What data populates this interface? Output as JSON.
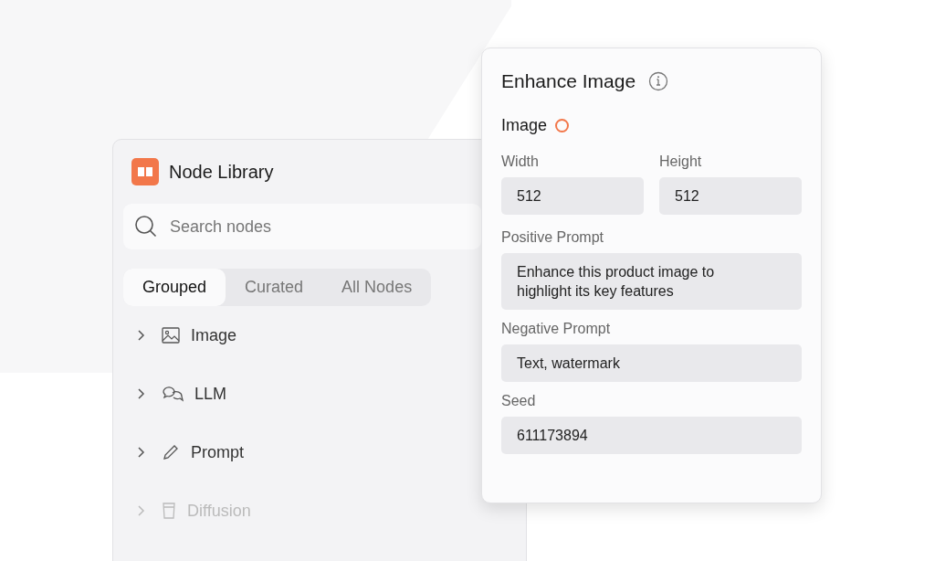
{
  "library": {
    "title": "Node Library",
    "search": {
      "placeholder": "Search nodes"
    },
    "tabs": [
      {
        "label": "Grouped",
        "selected": true
      },
      {
        "label": "Curated",
        "selected": false
      },
      {
        "label": "All Nodes",
        "selected": false
      }
    ],
    "groups": [
      {
        "label": "Image",
        "expanded": false,
        "disabled": false
      },
      {
        "label": "LLM",
        "expanded": false,
        "disabled": false
      },
      {
        "label": "Prompt",
        "expanded": false,
        "disabled": false
      },
      {
        "label": "Diffusion",
        "expanded": false,
        "disabled": true
      }
    ]
  },
  "node": {
    "title": "Enhance Image",
    "input": {
      "label": "Image",
      "connected": false
    },
    "size_fields": [
      {
        "label": "Width",
        "value": "512"
      },
      {
        "label": "Height",
        "value": "512"
      }
    ],
    "fields": [
      {
        "label": "Positive Prompt",
        "value": "Enhance this product image to highlight its key features"
      },
      {
        "label": "Negative Prompt",
        "value": "Text, watermark"
      },
      {
        "label": "Seed",
        "value": "611173894"
      }
    ]
  }
}
